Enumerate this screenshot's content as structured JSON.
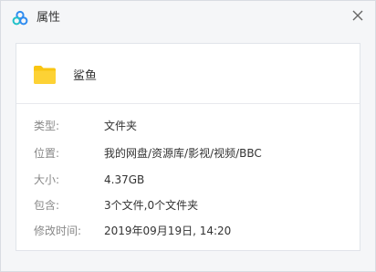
{
  "window": {
    "title": "属性"
  },
  "file": {
    "name": "鲨鱼"
  },
  "properties": [
    {
      "label": "类型:",
      "value": "文件夹"
    },
    {
      "label": "位置:",
      "value": "我的网盘/资源库/影视/视频/BBC"
    },
    {
      "label": "大小:",
      "value": "4.37GB"
    },
    {
      "label": "包含:",
      "value": "3个文件,0个文件夹"
    },
    {
      "label": "修改时间:",
      "value": "2019年09月19日, 14:20"
    }
  ],
  "icons": {
    "app": "cloud-icon",
    "close": "close-icon",
    "file": "folder-icon"
  },
  "colors": {
    "folder": "#f9c512",
    "app_icon_blue": "#2f8cf0",
    "app_icon_teal": "#21c1c9"
  }
}
